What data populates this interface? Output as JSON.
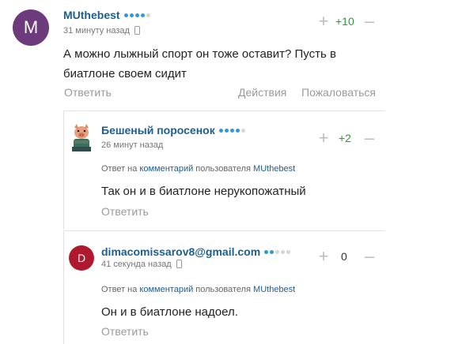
{
  "comments": [
    {
      "avatar_letter": "M",
      "avatar_color": "#6d3a7c",
      "username": "MUthebest",
      "time": "31 минуту назад",
      "rating_dots": [
        "#2b9cd8",
        "#2b9cd8",
        "#2b9cd8",
        "#2b9cd8",
        "#d6d6d6"
      ],
      "score": "+10",
      "text_lines": [
        "А можно лыжный спорт он тоже оставит? Пусть в",
        "биатлоне своем сидит"
      ],
      "reply_label": "Ответить",
      "actions_label": "Действия",
      "report_label": "Пожаловаться"
    },
    {
      "avatar_icon": "pig-avatar-icon",
      "username": "Бешеный поросенок",
      "time": "26 минут назад",
      "rating_dots": [
        "#2b9cd8",
        "#2b9cd8",
        "#2b9cd8",
        "#2b9cd8",
        "#d6d6d6"
      ],
      "score": "+2",
      "reply_to_prefix": "Ответ на",
      "reply_to_link": "комментарий",
      "reply_to_suffix": "пользователя",
      "reply_to_user": "MUthebest",
      "text": "Так он и в биатлоне нерукопожатный",
      "reply_label": "Ответить"
    },
    {
      "avatar_letter": "D",
      "avatar_color": "#b0182e",
      "username": "dimacomissarov8@gmail.com",
      "time": "41 секунда назад",
      "rating_dots": [
        "#2b9cd8",
        "#2b9cd8",
        "#d6d6d6",
        "#d6d6d6",
        "#d6d6d6"
      ],
      "score": "0",
      "reply_to_prefix": "Ответ на",
      "reply_to_link": "комментарий",
      "reply_to_suffix": "пользователя",
      "reply_to_user": "MUthebest",
      "text": "Он и в биатлоне надоел.",
      "reply_label": "Ответить"
    }
  ],
  "colors": {
    "positive_score": "#2e9a3a",
    "neutral_score": "#333333",
    "link": "#1a5f91"
  }
}
